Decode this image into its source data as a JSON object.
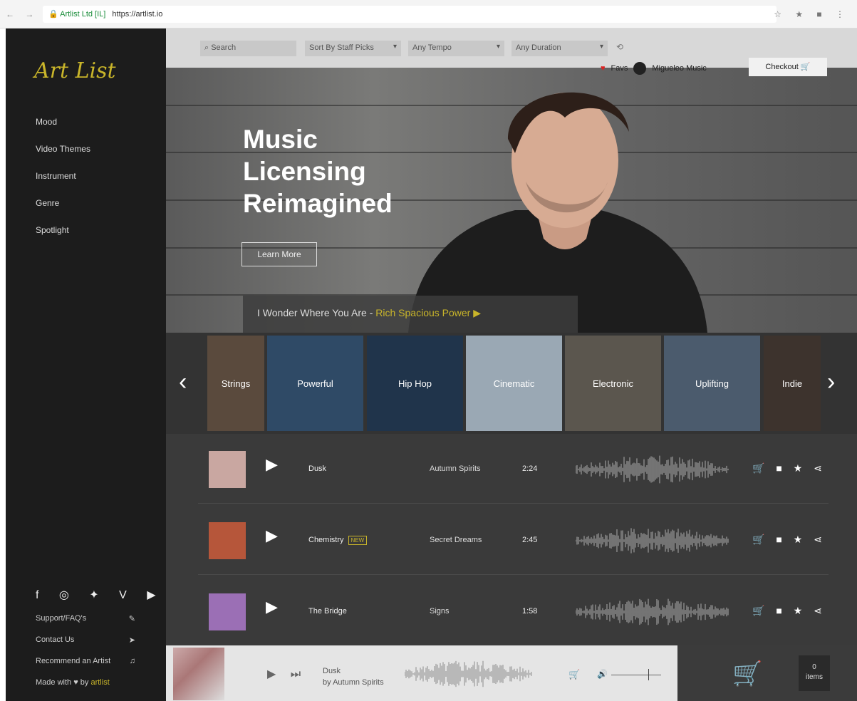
{
  "browser": {
    "nav_icons": "← → C",
    "site_name": "Artlist Ltd [IL]",
    "url": "https://artlist.io",
    "ext_icons": "☆ ★ ■ ⋮"
  },
  "sidebar": {
    "logo": "Art List",
    "menu": [
      "Mood",
      "Video Themes",
      "Instrument",
      "Genre",
      "Spotlight"
    ],
    "social_icons": "f ◎ ✦ V ▶",
    "footer": [
      {
        "label": "Support/FAQ's",
        "icon": "✎"
      },
      {
        "label": "Contact Us",
        "icon": "➤"
      },
      {
        "label": "Recommend an Artist",
        "icon": "♫"
      }
    ],
    "made_with": "Made with ♥ by",
    "made_by": "artlist"
  },
  "topbar": {
    "search_placeholder": "Search",
    "sort": "Sort By Staff Picks",
    "tempo": "Any Tempo",
    "duration": "Any Duration",
    "caret": "▾",
    "account": "Migueleo Music",
    "favs": "Favs",
    "checkout": "Checkout"
  },
  "hero": {
    "title_lines": [
      "Music",
      "Licensing",
      "Reimagined"
    ],
    "learn_more": "Learn More",
    "now_song": "I Wonder Where You Are -",
    "now_artist": "Rich Spacious Power",
    "now_play": "▶"
  },
  "carousel": {
    "prev": "‹",
    "next": "›",
    "tiles": [
      {
        "label": "Strings",
        "color": "#5a4a3d"
      },
      {
        "label": "Powerful",
        "color": "#2f4a66"
      },
      {
        "label": "Hip Hop",
        "color": "#20344b"
      },
      {
        "label": "Cinematic",
        "color": "#9aa8b4"
      },
      {
        "label": "Electronic",
        "color": "#5b564e"
      },
      {
        "label": "Uplifting",
        "color": "#4b5b6d"
      },
      {
        "label": "Indie",
        "color": "#3d332d"
      }
    ]
  },
  "tracks": [
    {
      "title": "Dusk",
      "badge": "",
      "artist": "Autumn Spirits",
      "duration": "2:24",
      "thumb_color": "#c9a7a1"
    },
    {
      "title": "Chemistry",
      "badge": "NEW",
      "artist": "Secret Dreams",
      "duration": "2:45",
      "thumb_color": "#b6563a"
    },
    {
      "title": "The Bridge",
      "badge": "",
      "artist": "Signs",
      "duration": "1:58",
      "thumb_color": "#9b6fb5"
    }
  ],
  "track_actions": "🛒 ■ ★ ⋖",
  "player": {
    "title": "Dusk",
    "artist": "by Autumn Spirits",
    "controls": "▶ ⏭",
    "cart": "🛒",
    "volume": "🔊",
    "items_count": "0",
    "items_label": "items"
  }
}
